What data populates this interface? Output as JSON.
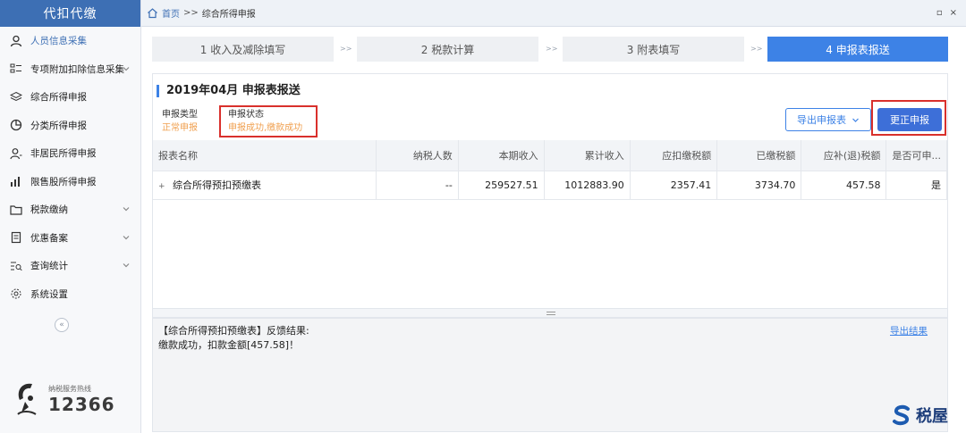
{
  "sidebar": {
    "title": "代扣代缴",
    "items": [
      {
        "label": "人员信息采集",
        "icon": "person-icon",
        "active": true
      },
      {
        "label": "专项附加扣除信息采集",
        "icon": "list-icon",
        "expand": true
      },
      {
        "label": "综合所得申报",
        "icon": "layers-icon"
      },
      {
        "label": "分类所得申报",
        "icon": "pie-icon"
      },
      {
        "label": "非居民所得申报",
        "icon": "person-tag-icon"
      },
      {
        "label": "限售股所得申报",
        "icon": "bar-chart-icon"
      },
      {
        "label": "税款缴纳",
        "icon": "folder-icon",
        "expand": true
      },
      {
        "label": "优惠备案",
        "icon": "document-icon",
        "expand": true
      },
      {
        "label": "查询统计",
        "icon": "search-list-icon",
        "expand": true
      },
      {
        "label": "系统设置",
        "icon": "gear-icon"
      }
    ],
    "collapse": "«",
    "hotline_label": "纳税服务热线",
    "hotline_number": "12366"
  },
  "topbar": {
    "home": "首页",
    "sep": ">>",
    "current": "综合所得申报",
    "win_btns": [
      "▫",
      "×"
    ]
  },
  "steps": [
    {
      "label": "1 收入及减除填写",
      "active": false
    },
    {
      "label": "2 税款计算",
      "active": false
    },
    {
      "label": "3 附表填写",
      "active": false
    },
    {
      "label": "4 申报表报送",
      "active": true
    }
  ],
  "step_arrow": ">>",
  "card": {
    "title": "2019年04月  申报表报送",
    "meta": [
      {
        "key": "申报类型",
        "value": "正常申报"
      },
      {
        "key": "申报状态",
        "value": "申报成功,缴款成功"
      }
    ],
    "export_btn": "导出申报表",
    "correct_btn": "更正申报"
  },
  "table": {
    "headers": [
      "报表名称",
      "纳税人数",
      "本期收入",
      "累计收入",
      "应扣缴税额",
      "已缴税额",
      "应补(退)税额",
      "是否可申..."
    ],
    "rows": [
      [
        "综合所得预扣预缴表",
        "--",
        "259527.51",
        "1012883.90",
        "2357.41",
        "3734.70",
        "457.58",
        "是"
      ]
    ],
    "expand_glyph": "+"
  },
  "feedback": {
    "title": "【综合所得预扣预缴表】反馈结果:",
    "message": "缴款成功，扣款金额[457.58]！",
    "export_link": "导出结果"
  },
  "watermark": {
    "text": "税屋"
  },
  "colors": {
    "accent": "#3d82e6",
    "highlight": "#d9302c",
    "status": "#f0a050",
    "yes": "#2aa05a"
  }
}
